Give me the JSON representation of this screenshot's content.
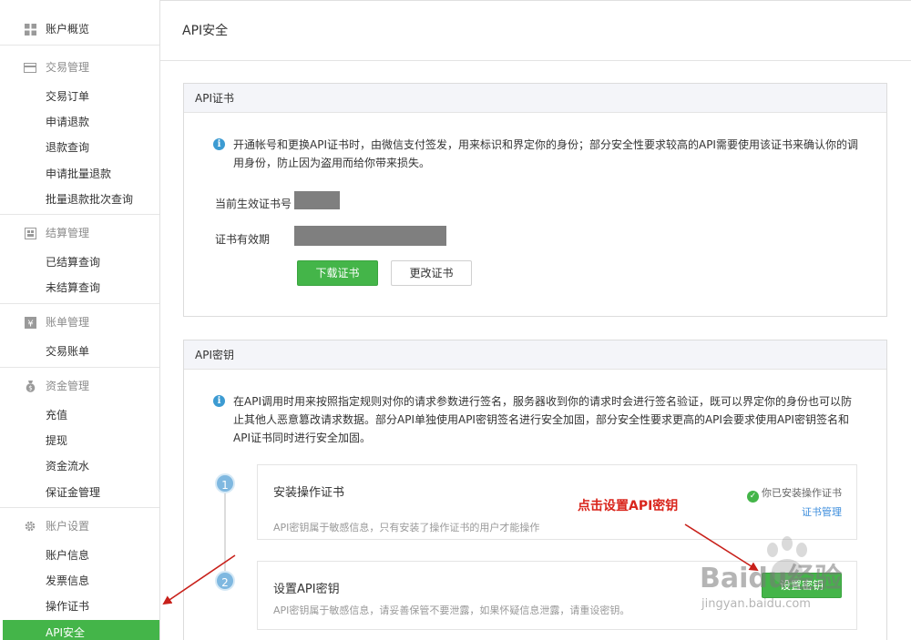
{
  "sidebar": {
    "overview_label": "账户概览",
    "groups": [
      {
        "title": "交易管理",
        "icon": "card-icon",
        "items": [
          "交易订单",
          "申请退款",
          "退款查询",
          "申请批量退款",
          "批量退款批次查询"
        ]
      },
      {
        "title": "结算管理",
        "icon": "settlement-icon",
        "items": [
          "已结算查询",
          "未结算查询"
        ]
      },
      {
        "title": "账单管理",
        "icon": "yen-icon",
        "items": [
          "交易账单"
        ]
      },
      {
        "title": "资金管理",
        "icon": "money-bag-icon",
        "items": [
          "充值",
          "提现",
          "资金流水",
          "保证金管理"
        ]
      },
      {
        "title": "账户设置",
        "icon": "gear-icon",
        "items": [
          "账户信息",
          "发票信息",
          "操作证书",
          "API安全"
        ]
      }
    ],
    "active_item": "API安全",
    "accent_color": "#44b549"
  },
  "main": {
    "page_title": "API安全",
    "cert_panel": {
      "title": "API证书",
      "info": "开通帐号和更换API证书时，由微信支付签发，用来标识和界定你的身份；部分安全性要求较高的API需要使用该证书来确认你的调用身份，防止因为盗用而给你带来损失。",
      "serial_label": "当前生效证书号",
      "validity_label": "证书有效期",
      "download_button": "下载证书",
      "change_button": "更改证书"
    },
    "key_panel": {
      "title": "API密钥",
      "info": "在API调用时用来按照指定规则对你的请求参数进行签名，服务器收到你的请求时会进行签名验证，既可以界定你的身份也可以防止其他人恶意篡改请求数据。部分API单独使用API密钥签名进行安全加固，部分安全性要求更高的API会要求使用API密钥签名和API证书同时进行安全加固。",
      "steps": [
        {
          "number": "1",
          "title": "安装操作证书",
          "desc": "API密钥属于敏感信息，只有安装了操作证书的用户才能操作",
          "status": "你已安装操作证书",
          "link": "证书管理"
        },
        {
          "number": "2",
          "title": "设置API密钥",
          "desc": "API密钥属于敏感信息，请妥善保管不要泄露，如果怀疑信息泄露，请重设密钥。",
          "button": "设置密钥"
        }
      ]
    }
  },
  "annotation": {
    "text": "点击设置API密钥",
    "color": "#d9251c"
  },
  "watermark": {
    "brand": "Baidu经验",
    "url": "jingyan.baidu.com"
  }
}
